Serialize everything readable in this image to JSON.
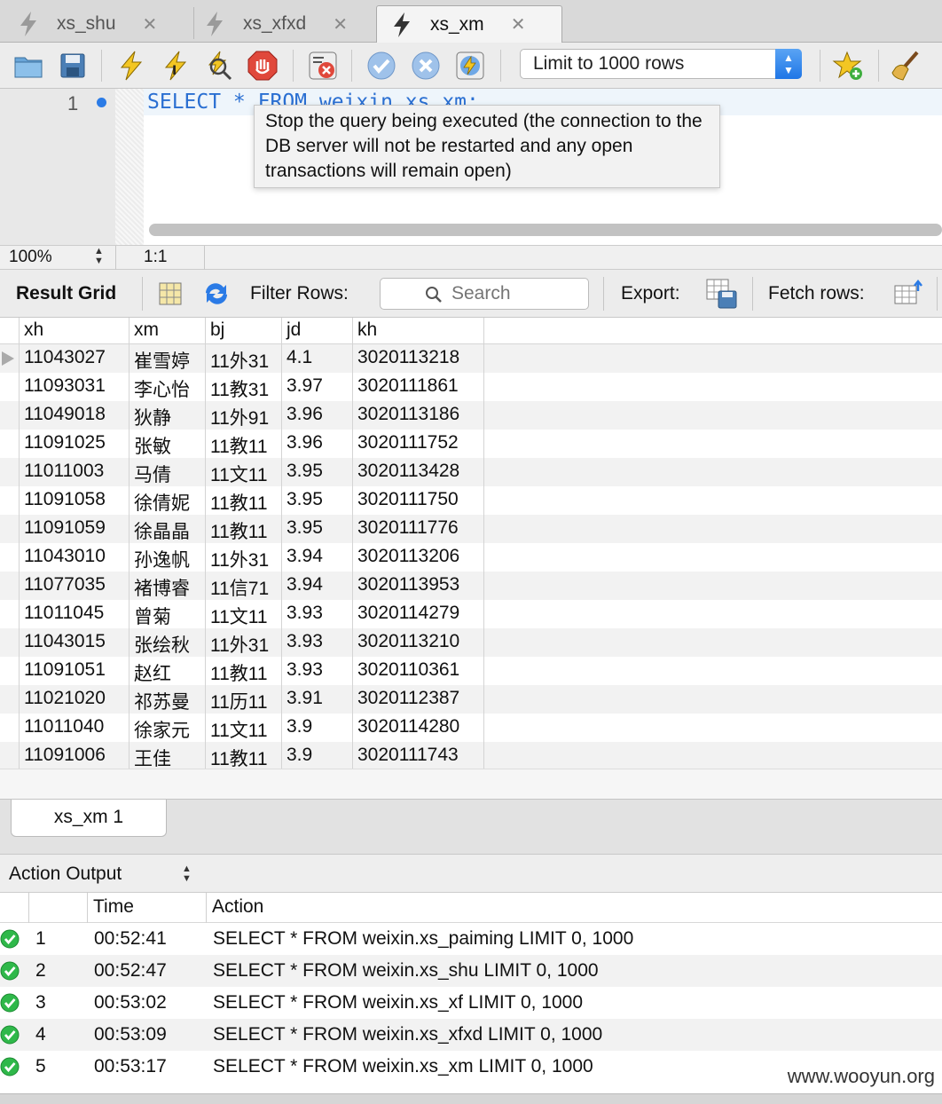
{
  "tabs": [
    {
      "label": "xs_shu",
      "active": false
    },
    {
      "label": "xs_xfxd",
      "active": false
    },
    {
      "label": "xs_xm",
      "active": true
    }
  ],
  "toolbar": {
    "icons": [
      "open-folder-icon",
      "save-icon",
      "execute-icon",
      "execute-current-icon",
      "explain-icon",
      "stop-icon",
      "toggle-error-icon",
      "commit-icon",
      "rollback-icon",
      "autocommit-icon",
      "add-snippet-icon",
      "beautify-icon"
    ],
    "limit_value": "Limit to 1000 rows"
  },
  "editor": {
    "line_number": "1",
    "code": "SELECT * FROM weixin.xs_xm;",
    "tooltip": "Stop the query being executed (the connection to the DB server will not be restarted and any open transactions will remain open)"
  },
  "status": {
    "zoom": "100%",
    "cursor": "1:1"
  },
  "result_toolbar": {
    "title": "Result Grid",
    "filter_label": "Filter Rows:",
    "search_placeholder": "Search",
    "export_label": "Export:",
    "fetch_label": "Fetch rows:"
  },
  "grid": {
    "columns": [
      "xh",
      "xm",
      "bj",
      "jd",
      "kh"
    ],
    "rows": [
      [
        "11043027",
        "崔雪婷",
        "11外31",
        "4.1",
        "3020113218"
      ],
      [
        "11093031",
        "李心怡",
        "11教31",
        "3.97",
        "3020111861"
      ],
      [
        "11049018",
        "狄静",
        "11外91",
        "3.96",
        "3020113186"
      ],
      [
        "11091025",
        "张敏",
        "11教11",
        "3.96",
        "3020111752"
      ],
      [
        "11011003",
        "马倩",
        "11文11",
        "3.95",
        "3020113428"
      ],
      [
        "11091058",
        "徐倩妮",
        "11教11",
        "3.95",
        "3020111750"
      ],
      [
        "11091059",
        "徐晶晶",
        "11教11",
        "3.95",
        "3020111776"
      ],
      [
        "11043010",
        "孙逸帆",
        "11外31",
        "3.94",
        "3020113206"
      ],
      [
        "11077035",
        "褚博睿",
        "11信71",
        "3.94",
        "3020113953"
      ],
      [
        "11011045",
        "曾菊",
        "11文11",
        "3.93",
        "3020114279"
      ],
      [
        "11043015",
        "张绘秋",
        "11外31",
        "3.93",
        "3020113210"
      ],
      [
        "11091051",
        "赵红",
        "11教11",
        "3.93",
        "3020110361"
      ],
      [
        "11021020",
        "祁苏曼",
        "11历11",
        "3.91",
        "3020112387"
      ],
      [
        "11011040",
        "徐家元",
        "11文11",
        "3.9",
        "3020114280"
      ],
      [
        "11091006",
        "王佳",
        "11教11",
        "3.9",
        "3020111743"
      ]
    ]
  },
  "result_tab": "xs_xm 1",
  "action_output": {
    "title": "Action Output",
    "columns": [
      "Time",
      "Action"
    ],
    "rows": [
      {
        "num": "1",
        "time": "00:52:41",
        "action": "SELECT * FROM weixin.xs_paiming LIMIT 0, 1000"
      },
      {
        "num": "2",
        "time": "00:52:47",
        "action": "SELECT * FROM weixin.xs_shu LIMIT 0, 1000"
      },
      {
        "num": "3",
        "time": "00:53:02",
        "action": "SELECT * FROM weixin.xs_xf LIMIT 0, 1000"
      },
      {
        "num": "4",
        "time": "00:53:09",
        "action": "SELECT * FROM weixin.xs_xfxd LIMIT 0, 1000"
      },
      {
        "num": "5",
        "time": "00:53:17",
        "action": "SELECT * FROM weixin.xs_xm LIMIT 0, 1000"
      }
    ]
  },
  "watermark": "www.wooyun.org",
  "colors": {
    "accent": "#2b7be6",
    "success": "#2fb84a",
    "stop": "#e0483b"
  }
}
